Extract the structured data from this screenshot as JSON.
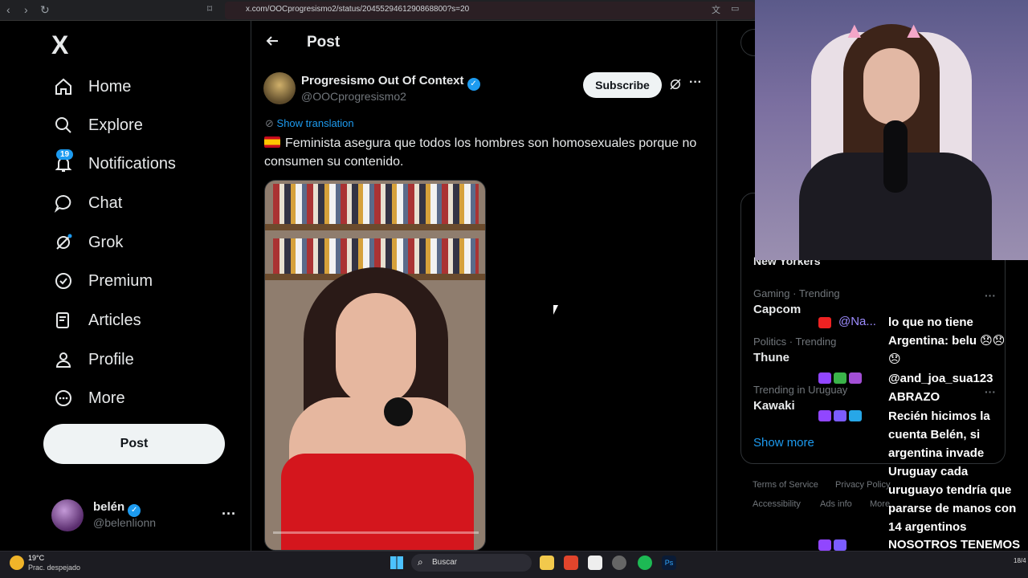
{
  "browser": {
    "url": "x.com/OOCprogresismo2/status/2045529461290868800?s=20"
  },
  "sidebar": {
    "logo": "X",
    "items": [
      {
        "label": "Home",
        "icon": "home-icon"
      },
      {
        "label": "Explore",
        "icon": "search-icon"
      },
      {
        "label": "Notifications",
        "icon": "bell-icon",
        "badge": "19"
      },
      {
        "label": "Chat",
        "icon": "chat-icon"
      },
      {
        "label": "Grok",
        "icon": "grok-icon"
      },
      {
        "label": "Premium",
        "icon": "verified-icon"
      },
      {
        "label": "Articles",
        "icon": "articles-icon"
      },
      {
        "label": "Profile",
        "icon": "person-icon"
      },
      {
        "label": "More",
        "icon": "more-circle-icon"
      }
    ],
    "post_button": "Post",
    "account": {
      "name": "belén",
      "handle": "@belenlionn",
      "more": "···"
    }
  },
  "main": {
    "title": "Post",
    "author": {
      "name": "Progresismo Out Of Context",
      "handle": "@OOCprogresismo2"
    },
    "subscribe_label": "Subscribe",
    "more": "···",
    "show_translation": "Show translation",
    "text": "Feminista asegura que todos los hombres son homosexuales porque no consumen su contenido."
  },
  "right": {
    "partial_trend_name": "New Yorkers",
    "trends": [
      {
        "category": "Gaming · Trending",
        "name": "Capcom"
      },
      {
        "category": "Politics · Trending",
        "name": "Thune"
      },
      {
        "category": "Trending in Uruguay",
        "name": "Kawaki"
      }
    ],
    "show_more": "Show more",
    "footer": {
      "terms": "Terms of Service",
      "privacy": "Privacy Policy",
      "accessibility": "Accessibility",
      "ads": "Ads info",
      "more": "More"
    }
  },
  "stream_chat": {
    "user1": "@Na...",
    "msg1": "lo que no tiene Argentina: belu 😞😞😞",
    "msg2": "@and_joa_sua123 ABRAZO",
    "msg3": "Recién hicimos la cuenta Belén, si argentina invade Uruguay cada uruguayo tendría que pararse de manos con 14 argentinos",
    "msg4": "NOSOTROS TENEMOS A SHEINBAUMMMM"
  },
  "taskbar": {
    "temp": "19°C",
    "weather": "Prac. despejado",
    "search": "Buscar",
    "date": "18/4"
  }
}
